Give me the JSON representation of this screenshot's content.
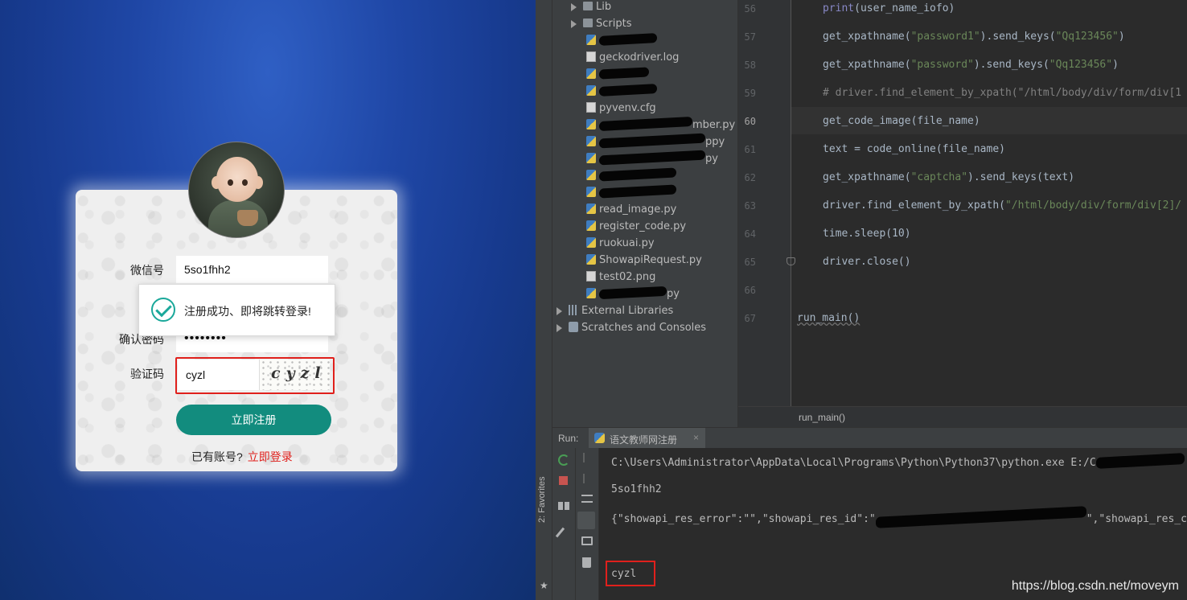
{
  "form": {
    "wechat_label": "微信号",
    "wechat_value": "5so1fhh2",
    "confirm_label": "确认密码",
    "confirm_value": "••••••••",
    "captcha_label": "验证码",
    "captcha_value": "cyzl",
    "captcha_image_text": "cyzl",
    "toast_text": "注册成功、即将跳转登录!",
    "register_button": "立即注册",
    "has_account": "已有账号?",
    "login_link": "立即登录"
  },
  "project_tree": {
    "lib": "Lib",
    "scripts": "Scripts",
    "gecko_log": "geckodriver.log",
    "pyvenv": "pyvenv.cfg",
    "suffix_1": "mber.py",
    "suffix_2": "ppy",
    "suffix_3": "py",
    "read_image": "read_image.py",
    "register_code": "register_code.py",
    "ruokuai": "ruokuai.py",
    "showapi": "ShowapiRequest.py",
    "test02": "test02.png",
    "suffix_4": "py",
    "external_libraries": "External Libraries",
    "scratches": "Scratches and Consoles"
  },
  "editor": {
    "line_numbers": [
      "56",
      "57",
      "58",
      "59",
      "60",
      "61",
      "62",
      "63",
      "64",
      "65",
      "66",
      "67"
    ],
    "line56_fn": "print",
    "line56_arg": "(user_name_iofo)",
    "line57_a": "get_xpathname(",
    "line57_s1": "\"password1\"",
    "line57_b": ").send_keys(",
    "line57_s2": "\"Qq123456\"",
    "line57_c": ")",
    "line58_a": "get_xpathname(",
    "line58_s1": "\"password\"",
    "line58_b": ").send_keys(",
    "line58_s2": "\"Qq123456\"",
    "line58_c": ")",
    "line59": "# driver.find_element_by_xpath(\"/html/body/div/form/div[1",
    "line60": "get_code_image(file_name)",
    "line61": "text = code_online(file_name)",
    "line62_a": "get_xpathname(",
    "line62_s": "\"captcha\"",
    "line62_b": ").send_keys(text)",
    "line63_a": "driver.find_element_by_xpath(",
    "line63_s": "\"/html/body/div/form/div[2]/",
    "line64": "time.sleep(10)",
    "line65": "driver.close()",
    "line67": "run_main()",
    "breadcrumb": "run_main()"
  },
  "run": {
    "label": "Run:",
    "tab_title": "语文教师网注册",
    "tab_close": "×",
    "favorites": "2: Favorites",
    "output_line1": "C:\\Users\\Administrator\\AppData\\Local\\Programs\\Python\\Python37\\python.exe E:/C",
    "output_line2": "5so1fhh2",
    "output_line3_a": "{\"showapi_res_error\":\"\",\"showapi_res_id\":\"",
    "output_line3_b": "\",\"showapi_res_c",
    "output_line4": "cyzl"
  },
  "watermark": "https://blog.csdn.net/moveym",
  "colors": {
    "accent_green": "#128c7e",
    "link_red": "#e0201c",
    "ide_bg": "#2b2b2b"
  }
}
